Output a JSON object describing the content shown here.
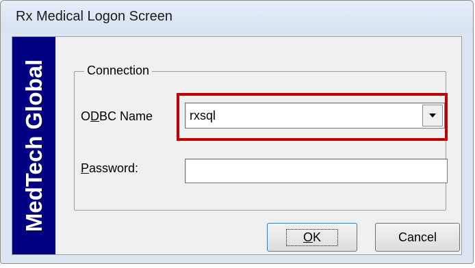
{
  "window": {
    "title": "Rx Medical Logon Screen"
  },
  "brand": {
    "text": "MedTech Global"
  },
  "connection": {
    "group_label": "Connection",
    "odbc": {
      "label_prefix": "O",
      "label_accel": "D",
      "label_suffix": "BC Name",
      "value": "rxsql"
    },
    "password": {
      "label_accel": "P",
      "label_suffix": "assword:",
      "value": ""
    }
  },
  "buttons": {
    "ok_accel": "O",
    "ok_suffix": "K",
    "cancel_label": "Cancel"
  },
  "colors": {
    "brand_bar": "#000080",
    "highlight": "#c00000"
  }
}
